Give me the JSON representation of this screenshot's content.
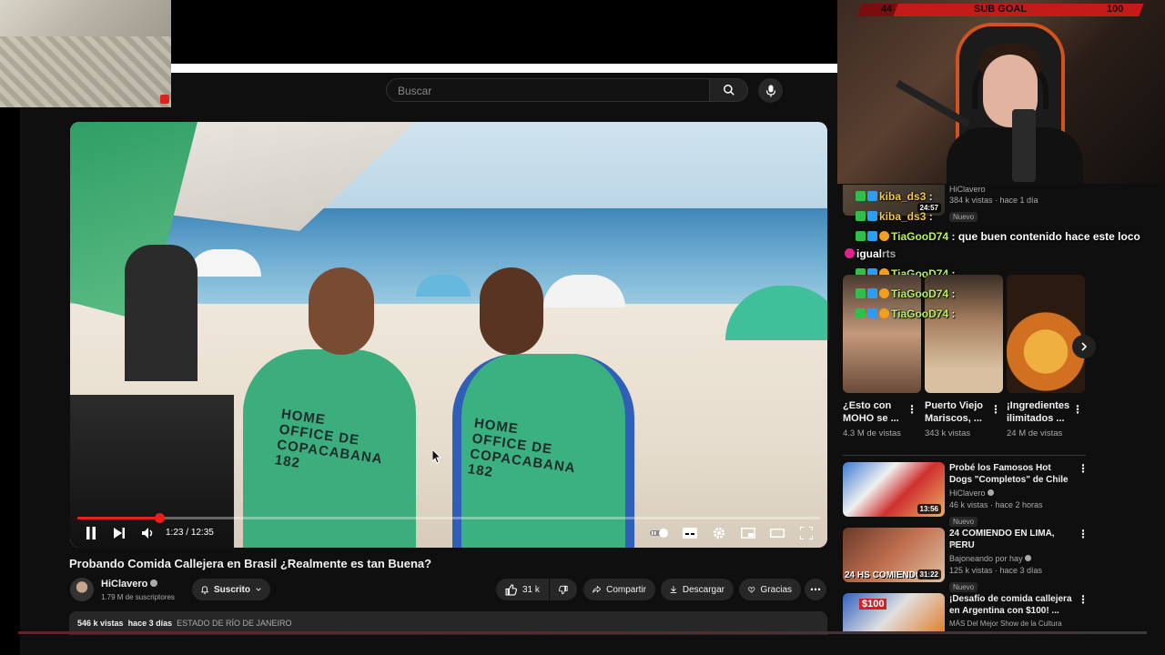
{
  "search": {
    "placeholder": "Buscar"
  },
  "player": {
    "current_time": "1:23",
    "duration": "12:35",
    "time_sep": " / ",
    "progress": 0.11,
    "shirt_text_1": "HOME OFFICE DE COPACABANA 182",
    "shirt_text_2": "HOME OFFICE DE COPACABANA 182"
  },
  "video": {
    "title": "Probando Comida Callejera en Brasil ¿Realmente es tan Buena?",
    "channel": "HiClavero",
    "subscribers": "1.79 M de suscriptores",
    "subscribe_label": "Suscrito",
    "likes": "31 k",
    "share_label": "Compartir",
    "download_label": "Descargar",
    "thanks_label": "Gracias",
    "views": "546 k vistas",
    "date": "hace 3 días",
    "location": "ESTADO DE RÍO DE JANEIRO"
  },
  "subgoal": {
    "current": "44",
    "label": "SUB GOAL",
    "target": "100"
  },
  "top_rec": {
    "channel": "HiClavero",
    "meta": "384 k vistas · hace 1 día",
    "badge": "Nuevo",
    "duration": "24:57"
  },
  "chat": [
    {
      "user": "kiba_ds3",
      "text": ""
    },
    {
      "user": "kiba_ds3",
      "text": ""
    },
    {
      "user": "TiaGooD74",
      "text": "que buen contenido hace este loco"
    },
    {
      "user": "",
      "text": "igual"
    },
    {
      "user": "TiaGooD74",
      "text": ""
    },
    {
      "user": "TiaGooD74",
      "text": ""
    },
    {
      "user": "TiaGooD74",
      "text": ""
    }
  ],
  "shorts_label": "rts",
  "shorts": [
    {
      "title": "¿Esto con MOHO se ...",
      "views": "4.3 M de vistas"
    },
    {
      "title": "Puerto Viejo Mariscos, ...",
      "views": "343 k vistas"
    },
    {
      "title": "¡Ingredientes ilimitados ...",
      "views": "24 M de vistas"
    }
  ],
  "recs": [
    {
      "title": "Probé los Famosos Hot Dogs \"Completos\" de Chile",
      "channel": "HiClavero",
      "meta": "46 k vistas · hace 2 horas",
      "badge": "Nuevo",
      "duration": "13:56",
      "thumb_text": ""
    },
    {
      "title": "24 COMIENDO EN LIMA, PERU",
      "sub": "PE",
      "channel": "Bajoneando por hay",
      "meta": "125 k vistas · hace 3 días",
      "badge": "Nuevo",
      "duration": "31:22",
      "thumb_text": "24 HS COMIENDO EN"
    },
    {
      "title": "¡Desafío de comida callejera en Argentina con $100! ...",
      "channel": "MÁS Del Mejor Show de la Cultura",
      "meta": "",
      "badge": "",
      "duration": "",
      "thumb_text": "$100"
    }
  ],
  "colors": {
    "accent": "#e62117",
    "chat_name": "#b9f25c"
  }
}
